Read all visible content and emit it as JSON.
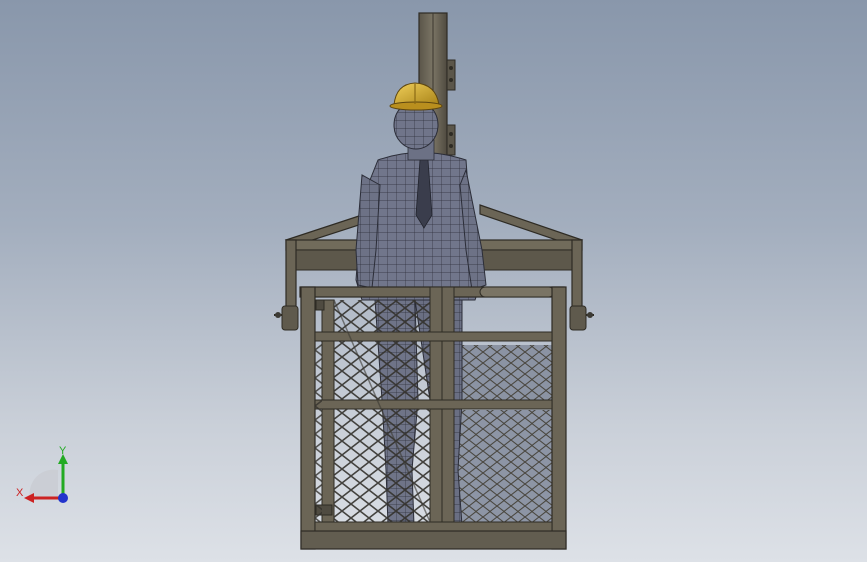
{
  "viewport": {
    "background_top": "#8997ab",
    "background_bottom": "#dde1e7"
  },
  "model": {
    "frame_color": "#6a6455",
    "frame_edge": "#2e2b24",
    "mesh_color": "#3c3a34",
    "figure_color": "#6f7488",
    "helmet_color": "#d2a626"
  },
  "triad": {
    "x_label": "X",
    "y_label": "Y",
    "x_color": "#cc2222",
    "y_color": "#22aa22",
    "z_color": "#2233cc"
  }
}
